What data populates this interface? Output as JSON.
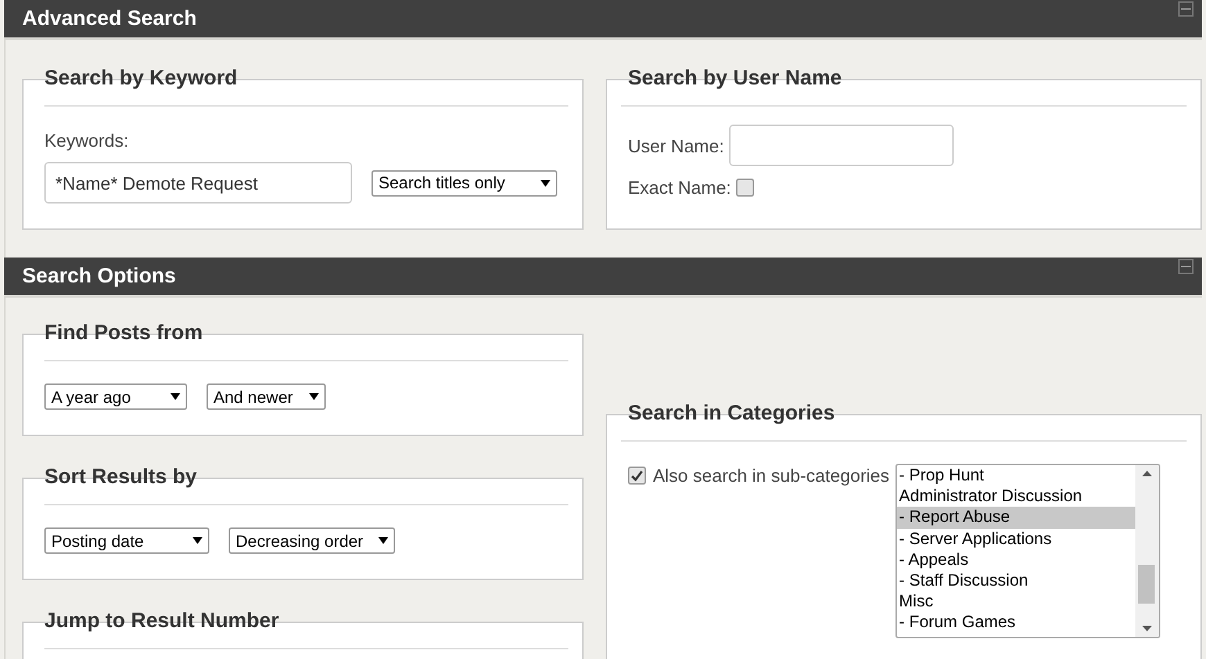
{
  "advanced_search": {
    "title": "Advanced Search",
    "keyword": {
      "legend": "Search by Keyword",
      "label": "Keywords:",
      "value": "*Name* Demote Request",
      "scope": "Search titles only"
    },
    "user_name": {
      "legend": "Search by User Name",
      "label": "User Name:",
      "exact_label": "Exact Name:",
      "exact_checked": false
    }
  },
  "search_options": {
    "title": "Search Options",
    "find_posts": {
      "legend": "Find Posts from",
      "period": "A year ago",
      "direction": "And newer"
    },
    "sort": {
      "legend": "Sort Results by",
      "field": "Posting date",
      "order": "Decreasing order"
    },
    "jump": {
      "legend": "Jump to Result Number"
    },
    "categories": {
      "legend": "Search in Categories",
      "subcategories_label": "Also search in sub-categories",
      "subcategories_checked": true,
      "items": [
        {
          "label": "- Prop Hunt",
          "selected": false
        },
        {
          "label": "Administrator Discussion",
          "selected": false
        },
        {
          "label": "- Report Abuse",
          "selected": true
        },
        {
          "label": "- Server Applications",
          "selected": false
        },
        {
          "label": "- Appeals",
          "selected": false
        },
        {
          "label": "- Staff Discussion",
          "selected": false
        },
        {
          "label": "Misc",
          "selected": false
        },
        {
          "label": "- Forum Games",
          "selected": false
        }
      ]
    }
  }
}
